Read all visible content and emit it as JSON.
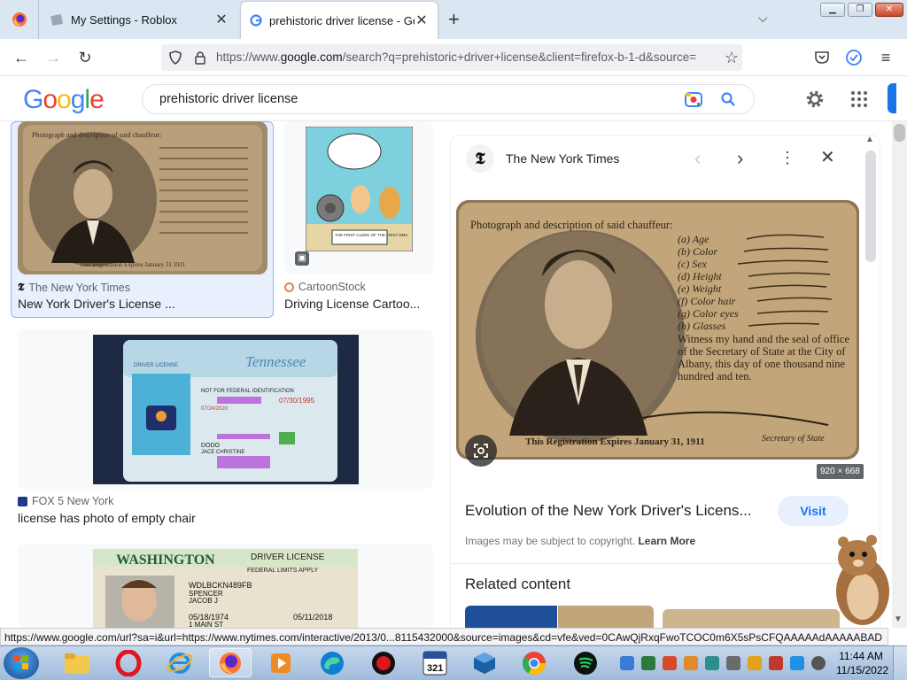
{
  "browser": {
    "tabs": [
      {
        "title": "My Settings - Roblox"
      },
      {
        "title": "prehistoric driver license - Goog"
      }
    ],
    "new_tab": "+",
    "url_prefix": "https://www.",
    "url_domain": "google.com",
    "url_rest": "/search?q=prehistoric+driver+license&client=firefox-b-1-d&source="
  },
  "google": {
    "logo": "Google",
    "query": "prehistoric driver license"
  },
  "results": [
    {
      "source": "The New York Times",
      "title": "New York Driver's License ..."
    },
    {
      "source": "CartoonStock",
      "title": "Driving License Cartoo..."
    },
    {
      "source": "FOX 5 New York",
      "title": "license has photo of empty chair"
    }
  ],
  "thumb_text": {
    "nyt_card": "Photograph and description of said chauffeur:",
    "nyt_expires": "This Registration Expires January 31 1911",
    "cartoon_caption": "THE FIRST CLERK OF THE FIRST DMV",
    "tn_title": "Tennessee",
    "tn_label": "DRIVER LICENSE",
    "tn_note": "NOT FOR FEDERAL IDENTIFICATION",
    "tn_exp": "07/30/1995",
    "tn_iss": "07/24/2020",
    "tn_name": "DODO",
    "tn_name2": "JACE CHRISTINE",
    "wa_title": "WASHINGTON",
    "wa_label": "DRIVER LICENSE",
    "wa_sub": "FEDERAL LIMITS APPLY",
    "wa_num": "WDLBCKN489FB",
    "wa_name": "SPENCER",
    "wa_name2": "JACOB J",
    "wa_dob": "05/18/1974",
    "wa_exp": "05/11/2018",
    "wa_addr": "1 MAIN ST"
  },
  "panel": {
    "source": "The New York Times",
    "big_card_line1": "Photograph and description of said chauffeur:",
    "big_card_rows": [
      "(a) Age",
      "(b) Color",
      "(c) Sex",
      "(d) Height",
      "(e) Weight",
      "(f) Color hair",
      "(g) Color eyes",
      "(h) Glasses"
    ],
    "big_card_witness": "Witness my hand and the seal of office of the Secretary of State at the City of Albany, this day of one thousand nine hundred and ten.",
    "big_card_expires": "This Registration Expires January 31, 1911",
    "big_card_sig": "Secretary of State",
    "dims": "920 × 668",
    "title": "Evolution of the New York Driver's Licens...",
    "visit": "Visit",
    "copyright": "Images may be subject to copyright.",
    "learn_more": "Learn More",
    "related": "Related content"
  },
  "status_url": "https://www.google.com/url?sa=i&url=https://www.nytimes.com/interactive/2013/0...8115432000&source=images&cd=vfe&ved=0CAwQjRxqFwoTCOC0m6X5sPsCFQAAAAAdAAAAABAD",
  "clock": {
    "time": "11:44 AM",
    "date": "11/15/2022"
  },
  "colors": {
    "google_blue": "#4285f4",
    "google_red": "#ea4335",
    "google_yellow": "#fbbc05",
    "google_green": "#34a853",
    "visit_bg": "#e8f0fe",
    "visit_fg": "#1a73e8"
  }
}
